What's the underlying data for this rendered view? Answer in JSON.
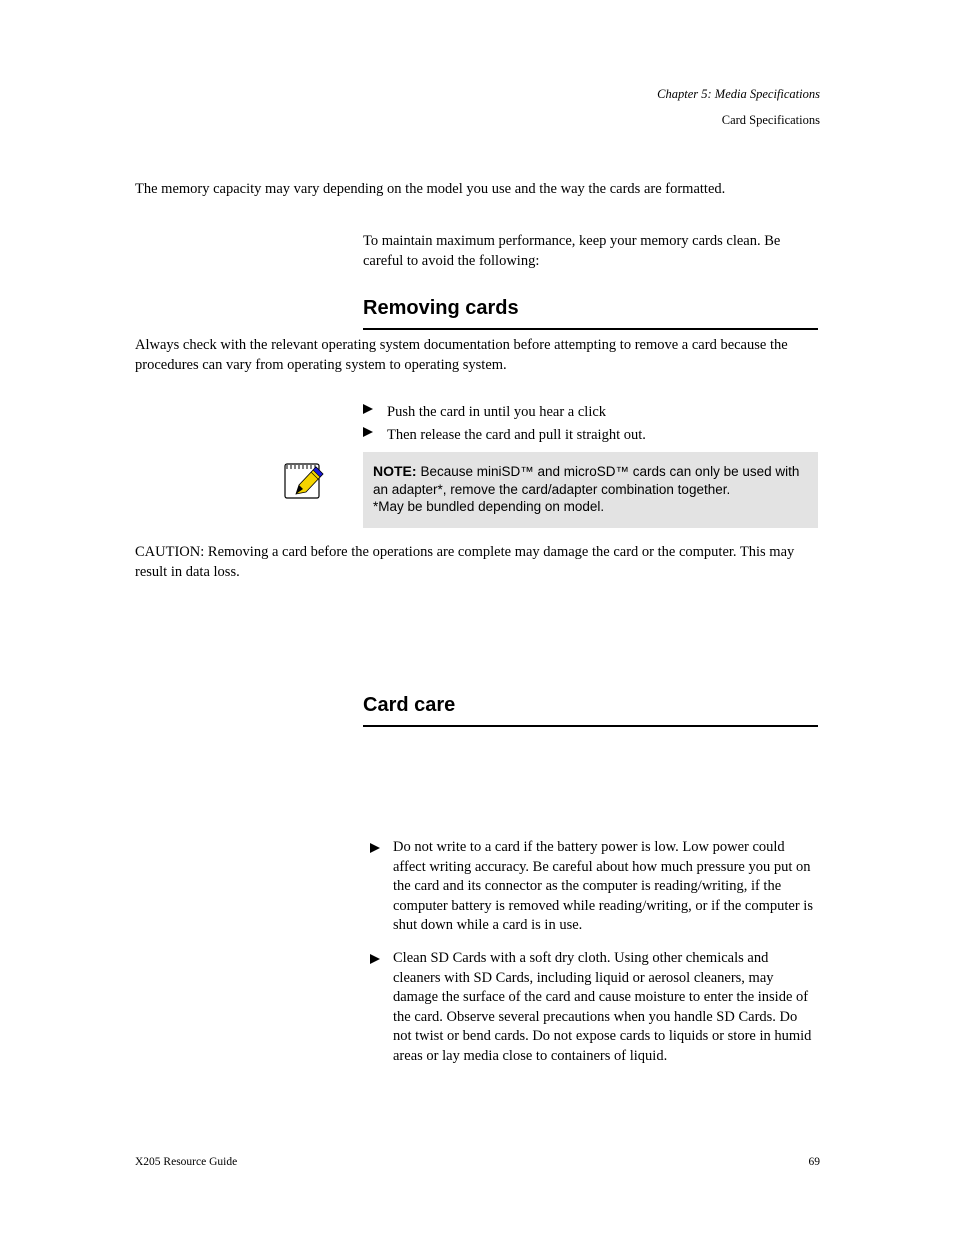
{
  "header": {
    "chapter": "Chapter 5: Media Specifications",
    "section": "Card Specifications"
  },
  "intro": {
    "para1": "The memory capacity may vary depending on the model you use and the way the cards are formatted.",
    "para2": "To maintain maximum performance, keep your memory cards clean. Be careful to avoid the following:"
  },
  "section1": {
    "heading": "Removing cards",
    "para1": "Always check with the relevant operating system documentation before attempting to remove a card because the procedures can vary from operating system to operating system.",
    "para2_label": "CAUTION: ",
    "para2_text": "Removing a card before the operations are complete may damage the card or the computer. This may result in data loss.",
    "item1": "Push the card in until you hear a click",
    "item2": "Then release the card and pull it straight out.",
    "note_label": "NOTE: ",
    "note_text": "Because miniSD™ and microSD™ cards can only be used with an adapter*, remove the card/adapter combination together.",
    "note_footnote": "*May be bundled depending on model."
  },
  "section2": {
    "heading": "Card care",
    "item1": {
      "lead": "Do not write to a card if the battery power is low.",
      "rest": " Low power could affect writing accuracy. Be careful about how much pressure you put on the card and its connector as the computer is reading/writing, if the computer battery is removed while reading/writing, or if the computer is shut down while a card is in use."
    },
    "item2": {
      "lead": "Clean SD Cards with a soft dry cloth.",
      "rest": " Using other chemicals and cleaners with SD Cards, including liquid or aerosol cleaners, may damage the surface of the card and cause moisture to enter the inside of the card. Observe several precautions when you handle SD Cards. Do not twist or bend cards. Do not expose cards to liquids or store in humid areas or lay media close to containers of liquid."
    }
  },
  "footer": {
    "left": "X205 Resource Guide",
    "right": "69"
  }
}
